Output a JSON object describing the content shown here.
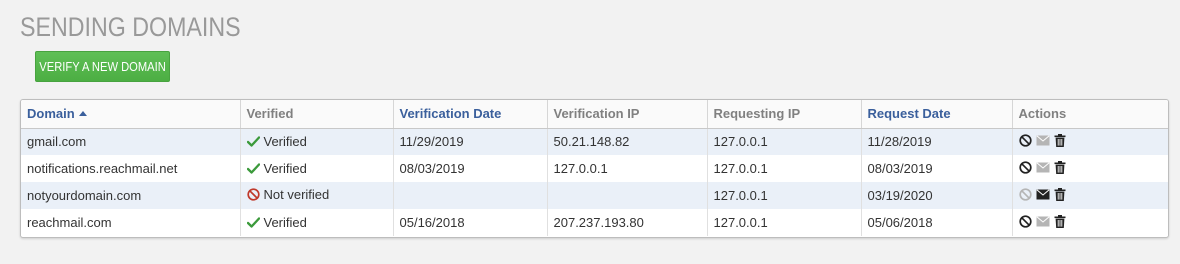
{
  "page": {
    "title": "SENDING DOMAINS",
    "verify_button_label": "VERIFY A NEW DOMAIN"
  },
  "colors": {
    "verify_green": "#4cae43",
    "check_green": "#3b9a3b",
    "not_verified_red": "#c0392b",
    "sortable_header": "#3a5f9c",
    "row_stripe": "#eaf0f8"
  },
  "table": {
    "columns": {
      "domain": "Domain",
      "verified": "Verified",
      "verification_date": "Verification Date",
      "verification_ip": "Verification IP",
      "requesting_ip": "Requesting IP",
      "request_date": "Request Date",
      "actions": "Actions"
    },
    "sorted_by": "Domain",
    "sort_direction": "ascending",
    "rows": [
      {
        "domain": "gmail.com",
        "verified": "Verified",
        "status": "verified",
        "verification_date": "11/29/2019",
        "verification_ip": "50.21.148.82",
        "requesting_ip": "127.0.0.1",
        "request_date": "11/28/2019",
        "actions": {
          "cancel": "active",
          "email": "disabled",
          "delete": "active"
        }
      },
      {
        "domain": "notifications.reachmail.net",
        "verified": "Verified",
        "status": "verified",
        "verification_date": "08/03/2019",
        "verification_ip": "127.0.0.1",
        "requesting_ip": "127.0.0.1",
        "request_date": "08/03/2019",
        "actions": {
          "cancel": "active",
          "email": "disabled",
          "delete": "active"
        }
      },
      {
        "domain": "notyourdomain.com",
        "verified": "Not verified",
        "status": "not-verified",
        "verification_date": "",
        "verification_ip": "",
        "requesting_ip": "127.0.0.1",
        "request_date": "03/19/2020",
        "actions": {
          "cancel": "disabled",
          "email": "active",
          "delete": "active"
        }
      },
      {
        "domain": "reachmail.com",
        "verified": "Verified",
        "status": "verified",
        "verification_date": "05/16/2018",
        "verification_ip": "207.237.193.80",
        "requesting_ip": "127.0.0.1",
        "request_date": "05/06/2018",
        "actions": {
          "cancel": "active",
          "email": "disabled",
          "delete": "active"
        }
      }
    ]
  }
}
